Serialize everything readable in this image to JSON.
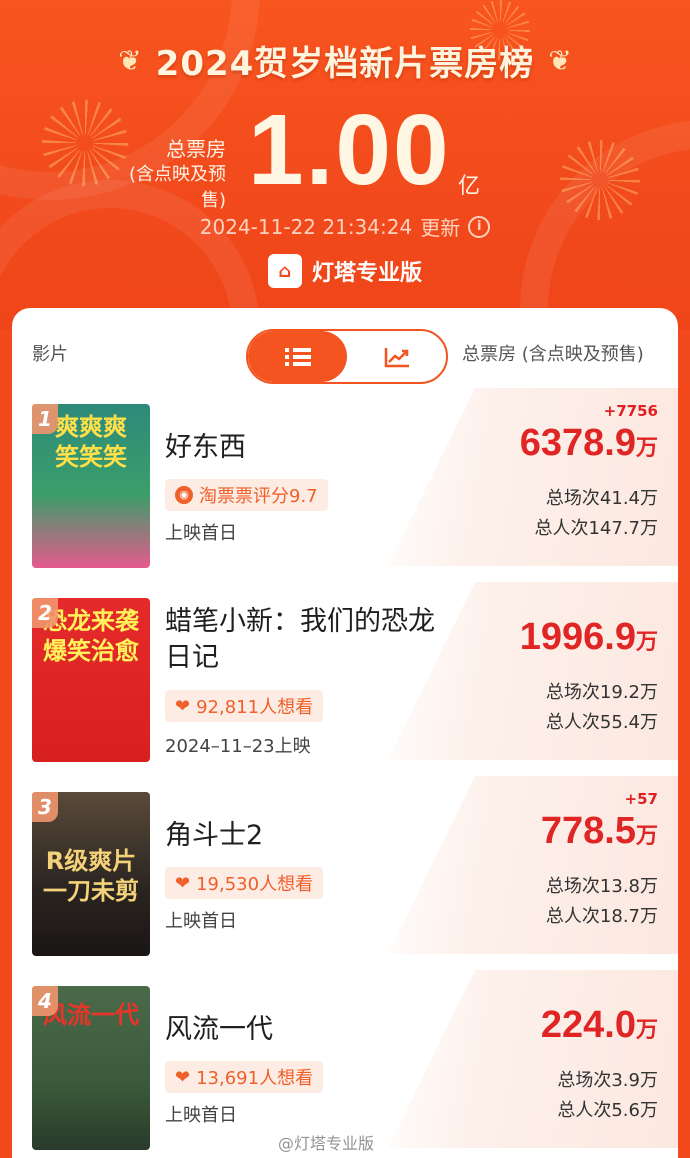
{
  "header": {
    "title": "2024贺岁档新片票房榜",
    "total_label_1": "总票房",
    "total_label_2": "(含点映及预售)",
    "total_value": "1.00",
    "total_unit": "亿",
    "update_time": "2024-11-22 21:34:24",
    "update_label": "更新",
    "brand": "灯塔专业版"
  },
  "table": {
    "col_film": "影片",
    "col_gross": "总票房 (含点映及预售)"
  },
  "movies": [
    {
      "rank": "1",
      "title": "好东西",
      "poster_text": "爽爽爽\n笑笑笑",
      "tag": "淘票票评分9.7",
      "release": "上映首日",
      "delta": "+7756",
      "gross": "6378.9",
      "unit": "万",
      "shows": "总场次41.4万",
      "viewers": "总人次147.7万"
    },
    {
      "rank": "2",
      "title": "蜡笔小新：我们的恐龙日记",
      "poster_text": "恐龙来袭\n爆笑治愈",
      "tag": "92,811人想看",
      "release": "2024–11–23上映",
      "delta": "",
      "gross": "1996.9",
      "unit": "万",
      "shows": "总场次19.2万",
      "viewers": "总人次55.4万"
    },
    {
      "rank": "3",
      "title": "角斗士2",
      "poster_text": "R级爽片\n一刀未剪",
      "tag": "19,530人想看",
      "release": "上映首日",
      "delta": "+57",
      "gross": "778.5",
      "unit": "万",
      "shows": "总场次13.8万",
      "viewers": "总人次18.7万"
    },
    {
      "rank": "4",
      "title": "风流一代",
      "poster_text": "风流一代",
      "tag": "13,691人想看",
      "release": "上映首日",
      "delta": "",
      "gross": "224.0",
      "unit": "万",
      "shows": "总场次3.9万",
      "viewers": "总人次5.6万"
    }
  ],
  "watermark": "@灯塔专业版",
  "colors": {
    "accent": "#f24a1c",
    "gross": "#e02525"
  },
  "icons": [
    "laurel-icon",
    "info-icon",
    "list-icon",
    "chart-icon",
    "heart-icon",
    "rating-icon"
  ]
}
